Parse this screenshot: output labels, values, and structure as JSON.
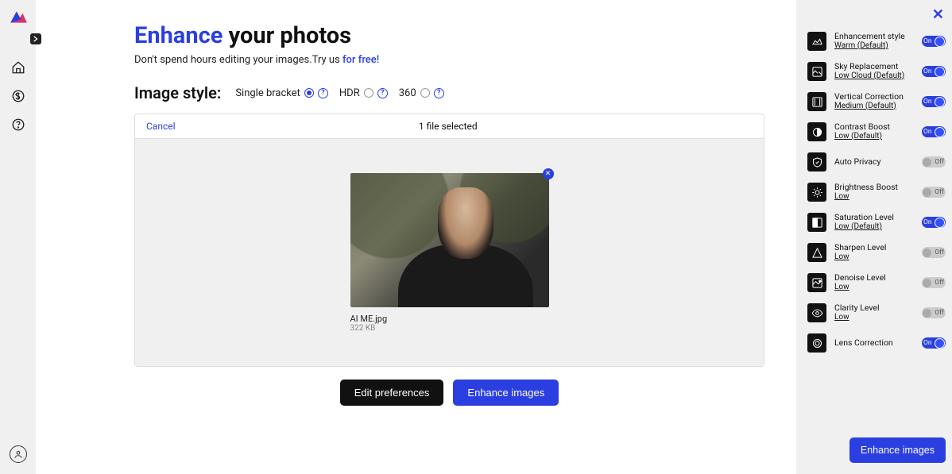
{
  "title": {
    "accent": "Enhance",
    "rest": " your photos"
  },
  "subtitle": {
    "text": "Don't spend hours editing your images.Try us ",
    "link": "for free!"
  },
  "style": {
    "label": "Image style:",
    "options": [
      {
        "label": "Single bracket",
        "selected": true
      },
      {
        "label": "HDR",
        "selected": false
      },
      {
        "label": "360",
        "selected": false
      }
    ]
  },
  "panel": {
    "cancel": "Cancel",
    "status": "1 file selected",
    "file": {
      "name": "AI ME.jpg",
      "size": "322 KB"
    }
  },
  "buttons": {
    "edit": "Edit preferences",
    "enhance": "Enhance images"
  },
  "sidebar": {
    "close": "✕",
    "items": [
      {
        "title": "Enhancement style",
        "sub": "Warm (Default)",
        "on": true,
        "icon": "enhance"
      },
      {
        "title": "Sky Replacement",
        "sub": "Low Cloud (Default)",
        "on": true,
        "icon": "sky"
      },
      {
        "title": "Vertical Correction",
        "sub": "Medium (Default)",
        "on": true,
        "icon": "vertical"
      },
      {
        "title": "Contrast Boost",
        "sub": "Low (Default)",
        "on": true,
        "icon": "contrast"
      },
      {
        "title": "Auto Privacy",
        "sub": "",
        "on": false,
        "icon": "privacy"
      },
      {
        "title": "Brightness Boost",
        "sub": "Low",
        "on": false,
        "icon": "brightness"
      },
      {
        "title": "Saturation Level",
        "sub": "Low (Default)",
        "on": true,
        "icon": "saturation"
      },
      {
        "title": "Sharpen Level",
        "sub": "Low",
        "on": false,
        "icon": "sharpen"
      },
      {
        "title": "Denoise Level",
        "sub": "Low",
        "on": false,
        "icon": "denoise"
      },
      {
        "title": "Clarity Level",
        "sub": "Low",
        "on": false,
        "icon": "clarity"
      },
      {
        "title": "Lens Correction",
        "sub": "",
        "on": true,
        "icon": "lens"
      }
    ],
    "enhance": "Enhance images"
  },
  "toggle": {
    "on": "On",
    "off": "Off"
  }
}
